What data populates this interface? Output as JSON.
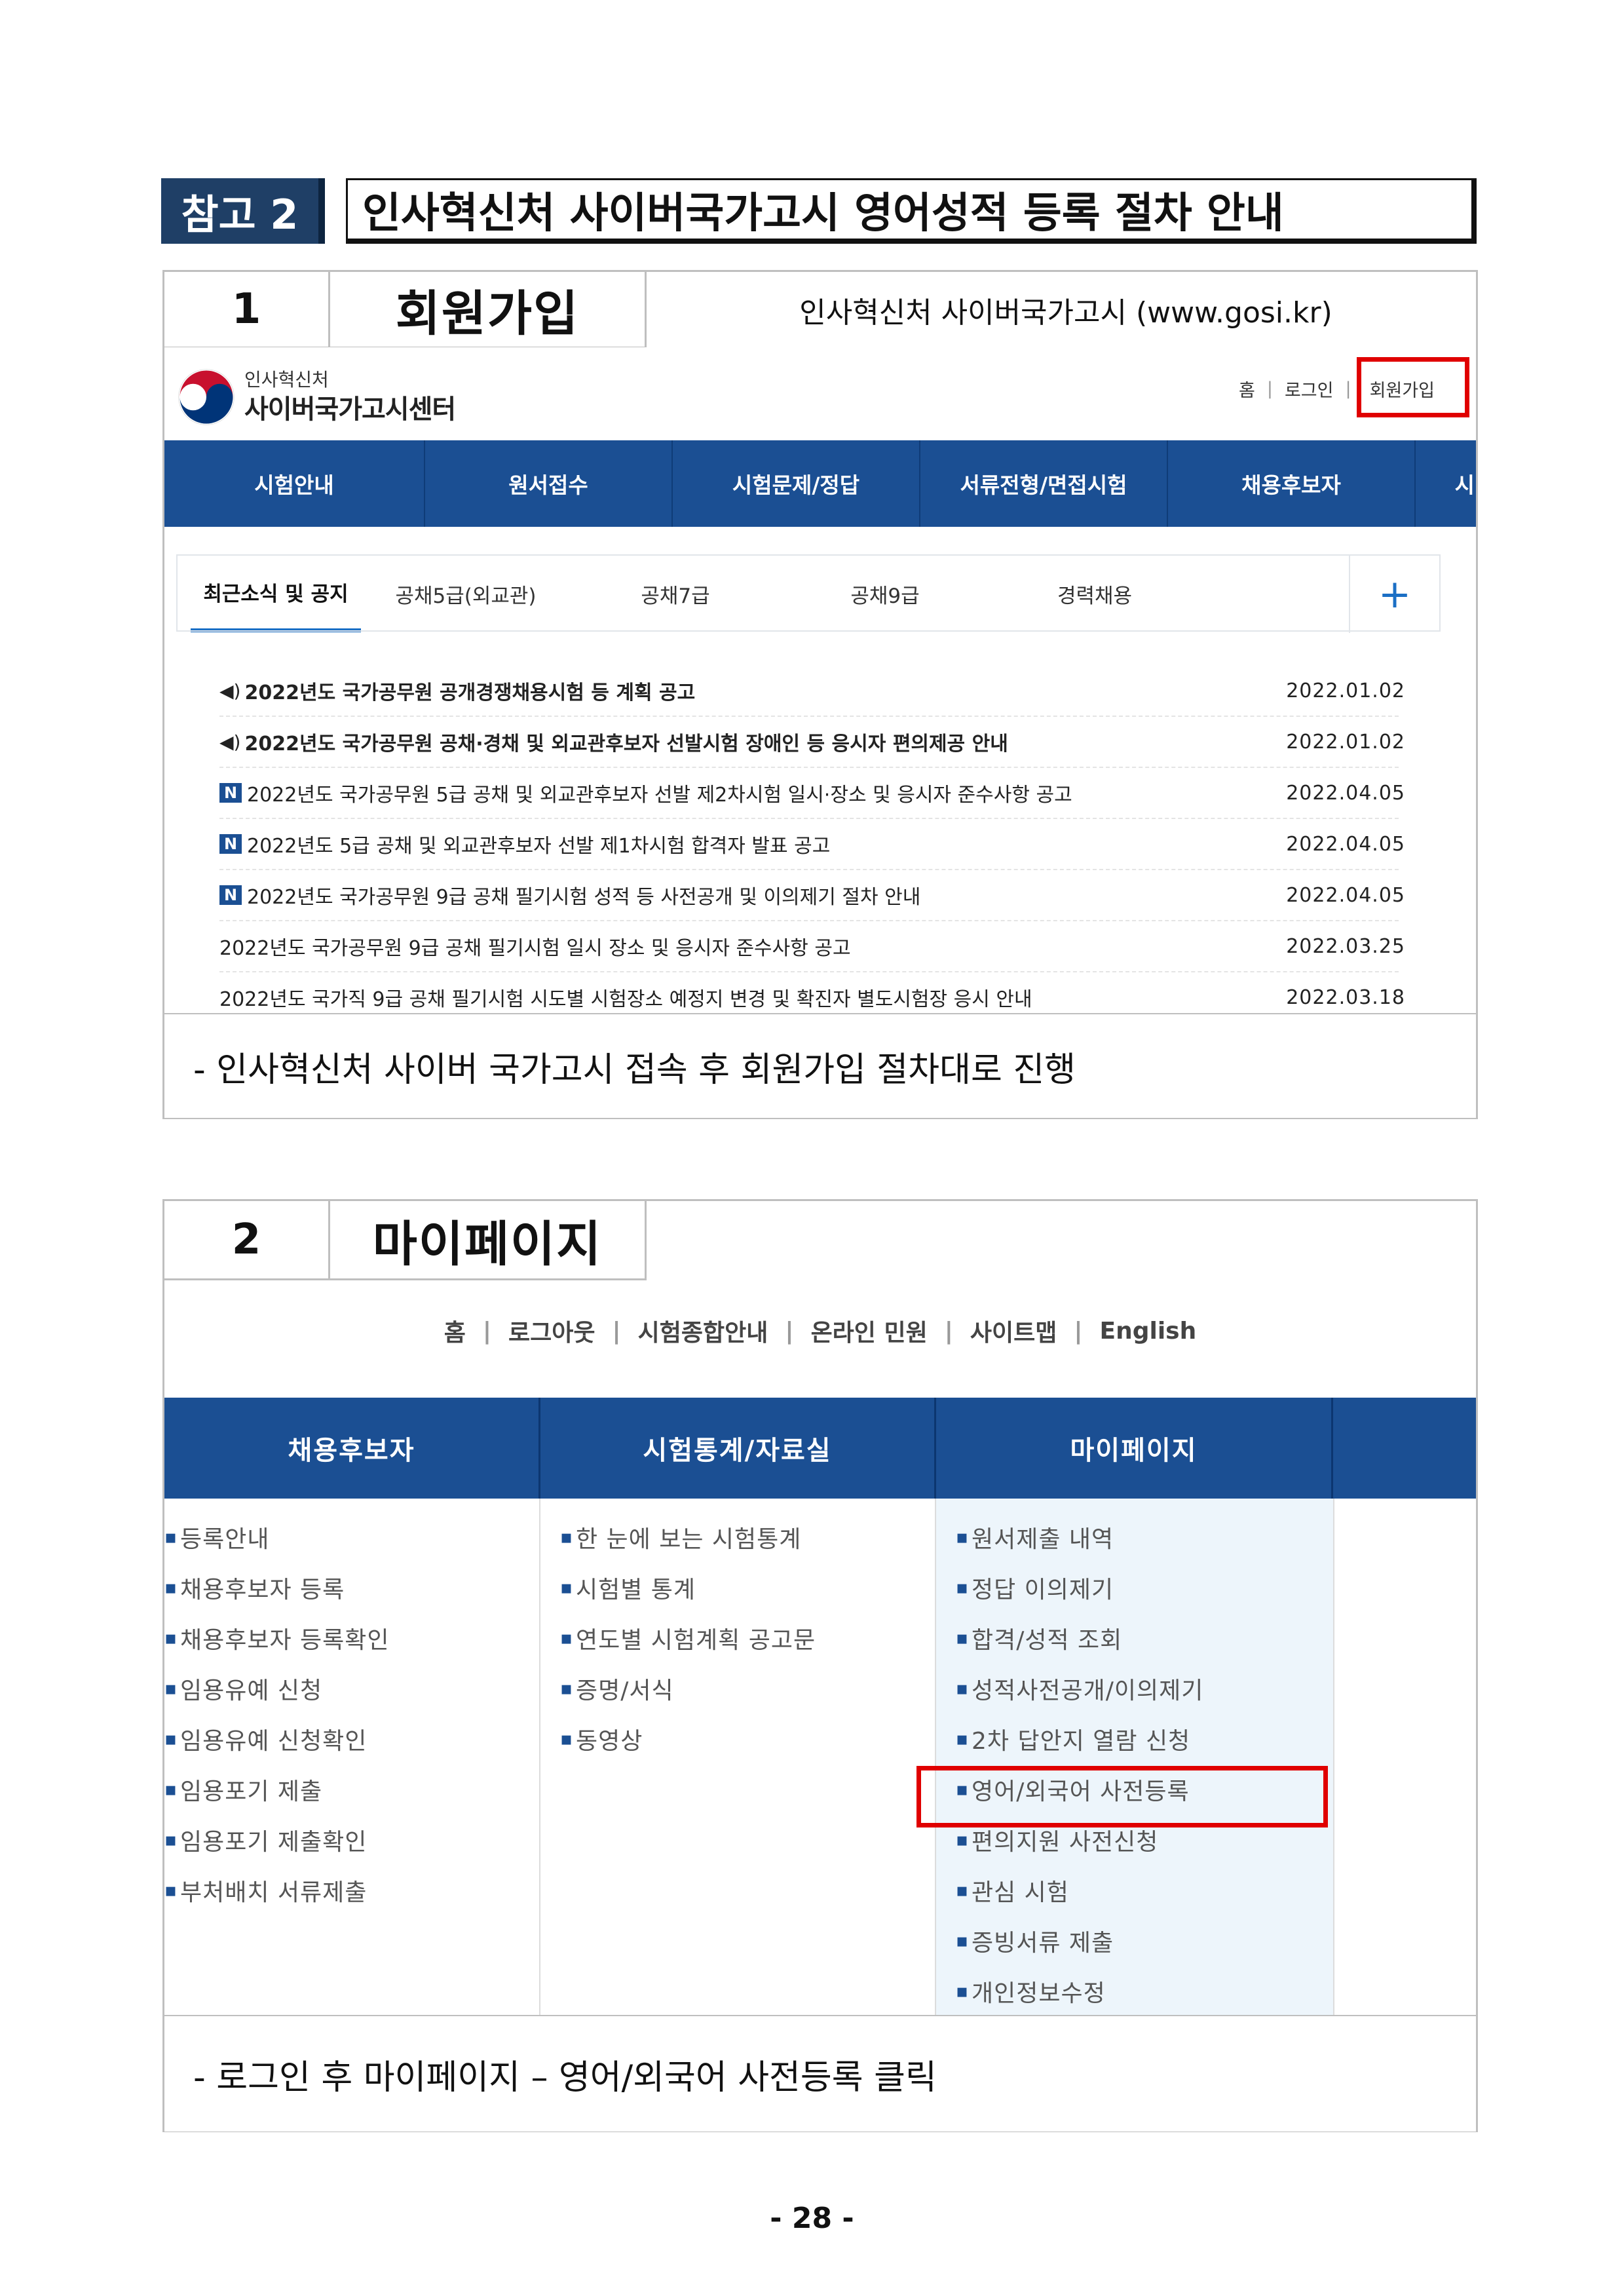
{
  "header": {
    "ref_label": "참고 2",
    "ref_title": "인사혁신처 사이버국가고시 영어성적 등록 절차 안내"
  },
  "step1": {
    "number": "1",
    "title": "회원가입",
    "site": "인사혁신처 사이버국가고시 (www.gosi.kr)",
    "note": "- 인사혁신처 사이버 국가고시 접속 후 회원가입 절차대로 진행",
    "screenshot": {
      "logo_small": "인사혁신처",
      "logo_big": "사이버국가고시센터",
      "util_links": [
        "홈",
        "로그인",
        "회원가입"
      ],
      "nav": [
        "시험안내",
        "원서접수",
        "시험문제/정답",
        "서류전형/면접시험",
        "채용후보자",
        "시"
      ],
      "tabs": [
        "최근소식 및 공지",
        "공채5급(외교관)",
        "공채7급",
        "공채9급",
        "경력채용"
      ],
      "tab_plus": "+",
      "news": [
        {
          "icon": "speaker",
          "title": "2022년도 국가공무원 공개경쟁채용시험 등 계획 공고",
          "date": "2022.01.02",
          "bold": true
        },
        {
          "icon": "speaker",
          "title": "2022년도 국가공무원 공채·경채 및 외교관후보자 선발시험 장애인 등 응시자 편의제공 안내",
          "date": "2022.01.02",
          "bold": true
        },
        {
          "icon": "N",
          "title": "2022년도 국가공무원 5급 공채 및 외교관후보자 선발 제2차시험 일시·장소 및 응시자 준수사항 공고",
          "date": "2022.04.05",
          "bold": false
        },
        {
          "icon": "N",
          "title": "2022년도 5급 공채 및 외교관후보자 선발 제1차시험 합격자 발표 공고",
          "date": "2022.04.05",
          "bold": false
        },
        {
          "icon": "N",
          "title": "2022년도 국가공무원 9급 공채 필기시험 성적 등 사전공개 및 이의제기 절차 안내",
          "date": "2022.04.05",
          "bold": false
        },
        {
          "icon": "",
          "title": "2022년도 국가공무원 9급 공채 필기시험 일시 장소 및 응시자 준수사항 공고",
          "date": "2022.03.25",
          "bold": false
        },
        {
          "icon": "",
          "title": "2022년도 국가직 9급 공채 필기시험 시도별 시험장소 예정지 변경 및 확진자 별도시험장 응시 안내",
          "date": "2022.03.18",
          "bold": false
        }
      ]
    }
  },
  "step2": {
    "number": "2",
    "title": "마이페이지",
    "note": "- 로그인 후 마이페이지 – 영어/외국어 사전등록 클릭",
    "screenshot": {
      "util_links": [
        "홈",
        "로그아웃",
        "시험종합안내",
        "온라인 민원",
        "사이트맵",
        "English"
      ],
      "nav": [
        "채용후보자",
        "시험통계/자료실",
        "마이페이지"
      ],
      "columns": [
        [
          "등록안내",
          "채용후보자 등록",
          "채용후보자 등록확인",
          "임용유예 신청",
          "임용유예 신청확인",
          "임용포기 제출",
          "임용포기 제출확인",
          "부처배치 서류제출"
        ],
        [
          "한 눈에 보는 시험통계",
          "시험별 통계",
          "연도별 시험계획 공고문",
          "증명/서식",
          "동영상"
        ],
        [
          "원서제출 내역",
          "정답 이의제기",
          "합격/성적 조회",
          "성적사전공개/이의제기",
          "2차 답안지 열람 신청",
          "영어/외국어 사전등록",
          "편의지원 사전신청",
          "관심 시험",
          "증빙서류 제출",
          "개인정보수정"
        ]
      ]
    }
  },
  "footer": {
    "page_number": "- 28 -"
  },
  "colors": {
    "navy": "#1f3f66",
    "nav_blue": "#1b4f93",
    "highlight_red": "#e00000"
  }
}
